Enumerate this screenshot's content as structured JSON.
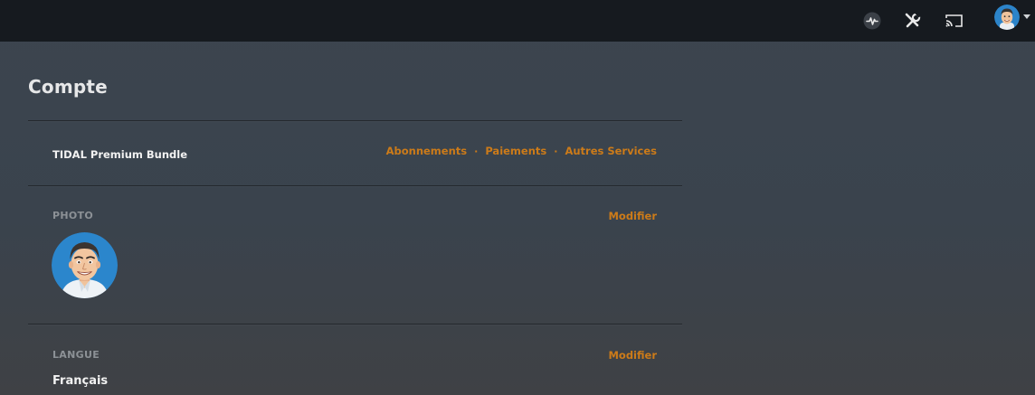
{
  "header": {
    "icons": [
      "activity-icon",
      "tools-icon",
      "cast-icon",
      "avatar",
      "chevron-down-icon"
    ]
  },
  "page": {
    "title": "Compte"
  },
  "subscription": {
    "plan_name": "TIDAL Premium Bundle",
    "links": [
      "Abonnements",
      "Paiements",
      "Autres Services"
    ],
    "separator": "·"
  },
  "photo": {
    "label": "PHOTO",
    "modify": "Modifier"
  },
  "language": {
    "label": "LANGUE",
    "modify": "Modifier",
    "value": "Français"
  },
  "colors": {
    "accent": "#cc7b19",
    "topbar": "#161a1f",
    "background": "#3c454f"
  }
}
